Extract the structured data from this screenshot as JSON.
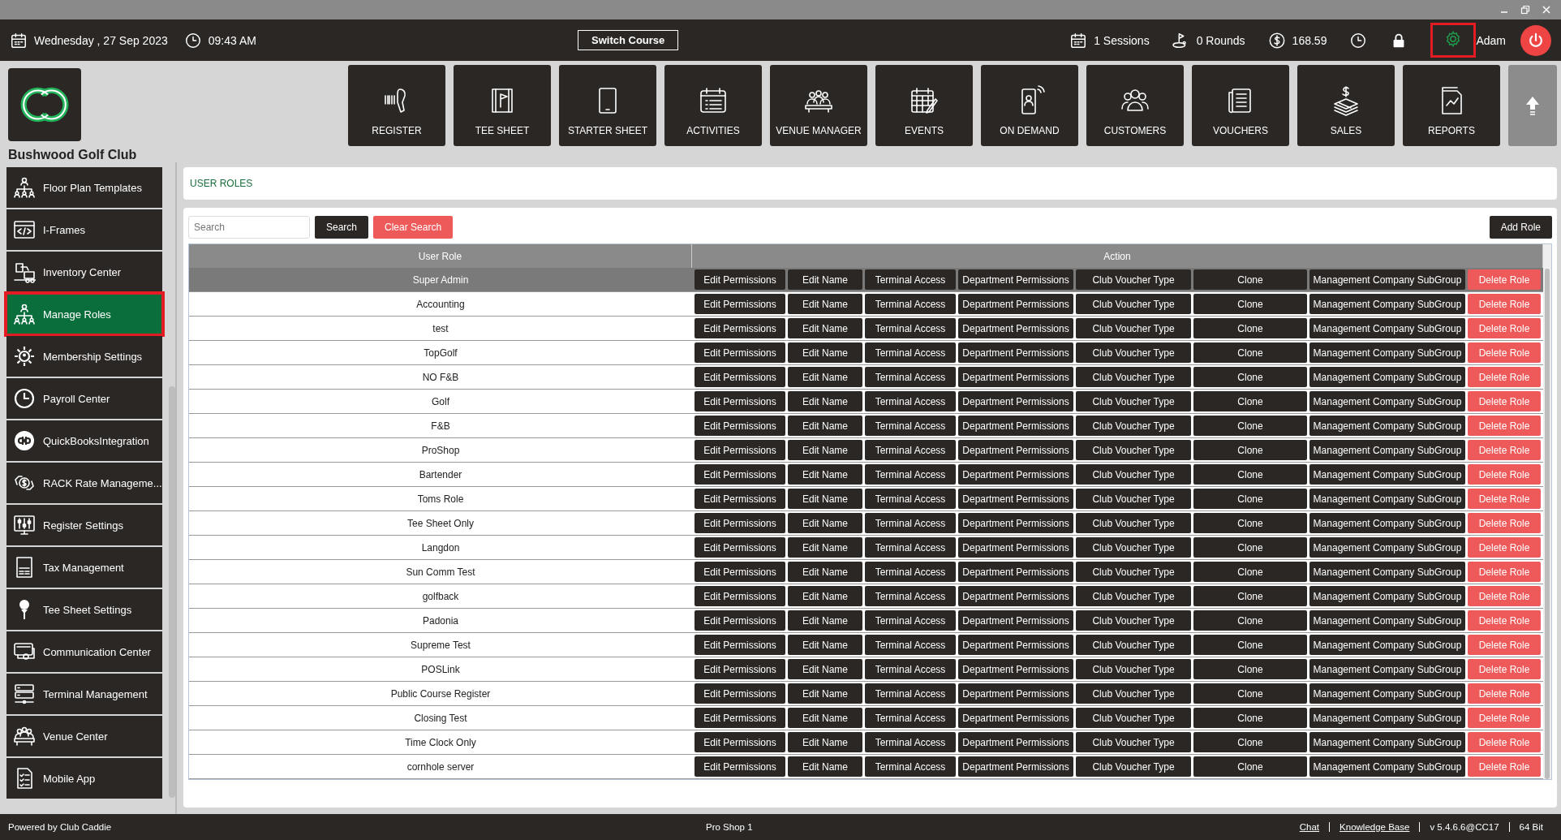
{
  "top_bar": {
    "date": "Wednesday ,  27 Sep 2023",
    "time": "09:43 AM",
    "switch_button": "Switch Course",
    "sessions": "1 Sessions",
    "rounds": "0 Rounds",
    "balance": "168.59",
    "settings_highlighted": true,
    "user": "Adam"
  },
  "club": {
    "name": "Bushwood Golf Club"
  },
  "nav": [
    {
      "label": "REGISTER"
    },
    {
      "label": "TEE SHEET"
    },
    {
      "label": "STARTER SHEET"
    },
    {
      "label": "ACTIVITIES"
    },
    {
      "label": "VENUE MANAGER"
    },
    {
      "label": "EVENTS"
    },
    {
      "label": "ON DEMAND"
    },
    {
      "label": "CUSTOMERS"
    },
    {
      "label": "VOUCHERS"
    },
    {
      "label": "SALES"
    },
    {
      "label": "REPORTS"
    }
  ],
  "sidebar": {
    "items": [
      {
        "label": "Floor Plan Templates",
        "selected": false
      },
      {
        "label": "I-Frames",
        "selected": false
      },
      {
        "label": "Inventory Center",
        "selected": false
      },
      {
        "label": "Manage Roles",
        "selected": true
      },
      {
        "label": "Membership Settings",
        "selected": false
      },
      {
        "label": "Payroll Center",
        "selected": false
      },
      {
        "label": "QuickBooksIntegration",
        "selected": false
      },
      {
        "label": "RACK Rate Manageme...",
        "selected": false
      },
      {
        "label": "Register Settings",
        "selected": false
      },
      {
        "label": "Tax Management",
        "selected": false
      },
      {
        "label": "Tee Sheet Settings",
        "selected": false
      },
      {
        "label": "Communication Center",
        "selected": false
      },
      {
        "label": "Terminal Management",
        "selected": false
      },
      {
        "label": "Venue Center",
        "selected": false
      },
      {
        "label": "Mobile App",
        "selected": false
      }
    ]
  },
  "page_title": "USER ROLES",
  "toolbar": {
    "search_placeholder": "Search",
    "search_button": "Search",
    "clear_button": "Clear Search",
    "add_button": "Add Role"
  },
  "table": {
    "columns": [
      "User Role",
      "Action"
    ],
    "rows": [
      {
        "role": "Super Admin",
        "selected": true,
        "actions": [
          "Edit Permissions",
          "Edit Name",
          "Terminal Access",
          "Department Permissions",
          "Club Voucher Type",
          "Clone",
          "Management Company SubGroup"
        ],
        "delete": "Delete Role"
      },
      {
        "role": "Accounting",
        "selected": false,
        "actions": [
          "Edit Permissions",
          "Edit Name",
          "Terminal Access",
          "Department Permissions",
          "Club Voucher Type",
          "Clone",
          "Management Company SubGroup"
        ],
        "delete": "Delete Role"
      },
      {
        "role": "test",
        "selected": false,
        "actions": [
          "Edit Permissions",
          "Edit Name",
          "Terminal Access",
          "Department Permissions",
          "Club Voucher Type",
          "Clone",
          "Management Company SubGroup"
        ],
        "delete": "Delete Role"
      },
      {
        "role": "TopGolf",
        "selected": false,
        "actions": [
          "Edit Permissions",
          "Edit Name",
          "Terminal Access",
          "Department Permissions",
          "Club Voucher Type",
          "Clone",
          "Management Company SubGroup"
        ],
        "delete": "Delete Role"
      },
      {
        "role": "NO F&B",
        "selected": false,
        "actions": [
          "Edit Permissions",
          "Edit Name",
          "Terminal Access",
          "Department Permissions",
          "Club Voucher Type",
          "Clone",
          "Management Company SubGroup"
        ],
        "delete": "Delete Role"
      },
      {
        "role": "Golf",
        "selected": false,
        "actions": [
          "Edit Permissions",
          "Edit Name",
          "Terminal Access",
          "Department Permissions",
          "Club Voucher Type",
          "Clone",
          "Management Company SubGroup"
        ],
        "delete": "Delete Role"
      },
      {
        "role": "F&B",
        "selected": false,
        "actions": [
          "Edit Permissions",
          "Edit Name",
          "Terminal Access",
          "Department Permissions",
          "Club Voucher Type",
          "Clone",
          "Management Company SubGroup"
        ],
        "delete": "Delete Role"
      },
      {
        "role": "ProShop",
        "selected": false,
        "actions": [
          "Edit Permissions",
          "Edit Name",
          "Terminal Access",
          "Department Permissions",
          "Club Voucher Type",
          "Clone",
          "Management Company SubGroup"
        ],
        "delete": "Delete Role"
      },
      {
        "role": "Bartender",
        "selected": false,
        "actions": [
          "Edit Permissions",
          "Edit Name",
          "Terminal Access",
          "Department Permissions",
          "Club Voucher Type",
          "Clone",
          "Management Company SubGroup"
        ],
        "delete": "Delete Role"
      },
      {
        "role": "Toms Role",
        "selected": false,
        "actions": [
          "Edit Permissions",
          "Edit Name",
          "Terminal Access",
          "Department Permissions",
          "Club Voucher Type",
          "Clone",
          "Management Company SubGroup"
        ],
        "delete": "Delete Role"
      },
      {
        "role": "Tee Sheet Only",
        "selected": false,
        "actions": [
          "Edit Permissions",
          "Edit Name",
          "Terminal Access",
          "Department Permissions",
          "Club Voucher Type",
          "Clone",
          "Management Company SubGroup"
        ],
        "delete": "Delete Role"
      },
      {
        "role": "Langdon",
        "selected": false,
        "actions": [
          "Edit Permissions",
          "Edit Name",
          "Terminal Access",
          "Department Permissions",
          "Club Voucher Type",
          "Clone",
          "Management Company SubGroup"
        ],
        "delete": "Delete Role"
      },
      {
        "role": "Sun Comm Test",
        "selected": false,
        "actions": [
          "Edit Permissions",
          "Edit Name",
          "Terminal Access",
          "Department Permissions",
          "Club Voucher Type",
          "Clone",
          "Management Company SubGroup"
        ],
        "delete": "Delete Role"
      },
      {
        "role": "golfback",
        "selected": false,
        "actions": [
          "Edit Permissions",
          "Edit Name",
          "Terminal Access",
          "Department Permissions",
          "Club Voucher Type",
          "Clone",
          "Management Company SubGroup"
        ],
        "delete": "Delete Role"
      },
      {
        "role": "Padonia",
        "selected": false,
        "actions": [
          "Edit Permissions",
          "Edit Name",
          "Terminal Access",
          "Department Permissions",
          "Club Voucher Type",
          "Clone",
          "Management Company SubGroup"
        ],
        "delete": "Delete Role"
      },
      {
        "role": "Supreme Test",
        "selected": false,
        "actions": [
          "Edit Permissions",
          "Edit Name",
          "Terminal Access",
          "Department Permissions",
          "Club Voucher Type",
          "Clone",
          "Management Company SubGroup"
        ],
        "delete": "Delete Role"
      },
      {
        "role": "POSLink",
        "selected": false,
        "actions": [
          "Edit Permissions",
          "Edit Name",
          "Terminal Access",
          "Department Permissions",
          "Club Voucher Type",
          "Clone",
          "Management Company SubGroup"
        ],
        "delete": "Delete Role"
      },
      {
        "role": "Public Course Register",
        "selected": false,
        "actions": [
          "Edit Permissions",
          "Edit Name",
          "Terminal Access",
          "Department Permissions",
          "Club Voucher Type",
          "Clone",
          "Management Company SubGroup"
        ],
        "delete": "Delete Role"
      },
      {
        "role": "Closing Test",
        "selected": false,
        "actions": [
          "Edit Permissions",
          "Edit Name",
          "Terminal Access",
          "Department Permissions",
          "Club Voucher Type",
          "Clone",
          "Management Company SubGroup"
        ],
        "delete": "Delete Role"
      },
      {
        "role": "Time Clock Only",
        "selected": false,
        "actions": [
          "Edit Permissions",
          "Edit Name",
          "Terminal Access",
          "Department Permissions",
          "Club Voucher Type",
          "Clone",
          "Management Company SubGroup"
        ],
        "delete": "Delete Role"
      },
      {
        "role": "cornhole server",
        "selected": false,
        "actions": [
          "Edit Permissions",
          "Edit Name",
          "Terminal Access",
          "Department Permissions",
          "Club Voucher Type",
          "Clone",
          "Management Company SubGroup"
        ],
        "delete": "Delete Role"
      }
    ]
  },
  "status_bar": {
    "powered_by": "Powered by Club Caddie",
    "location": "Pro Shop 1",
    "links": [
      "Chat",
      "Knowledge Base"
    ],
    "version": "v 5.4.6.6@CC17",
    "bits": "64 Bit"
  }
}
